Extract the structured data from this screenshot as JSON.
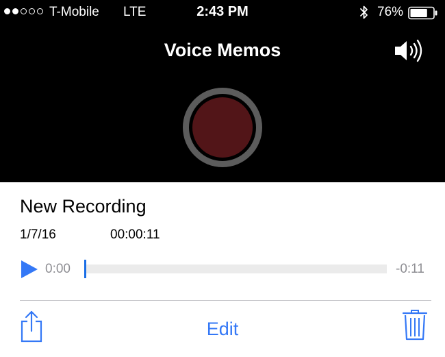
{
  "status_bar": {
    "signal_bars_filled": 2,
    "signal_bars_total": 5,
    "carrier": "T-Mobile",
    "network": "LTE",
    "time": "2:43 PM",
    "bluetooth_icon": "bluetooth-icon",
    "battery_percent": "76%",
    "battery_level": 0.76
  },
  "header": {
    "title": "Voice Memos",
    "speaker_icon": "speaker-icon"
  },
  "recorder": {
    "record_icon": "record-icon"
  },
  "recording": {
    "title": "New Recording",
    "date": "1/7/16",
    "duration": "00:00:11",
    "elapsed": "0:00",
    "remaining": "-0:11",
    "progress": 0
  },
  "toolbar": {
    "share_icon": "share-icon",
    "edit_label": "Edit",
    "trash_icon": "trash-icon"
  },
  "colors": {
    "accent": "#3478f6",
    "record": "#521518",
    "record_ring": "#5c5c5c",
    "muted_text": "#8e8e93"
  }
}
